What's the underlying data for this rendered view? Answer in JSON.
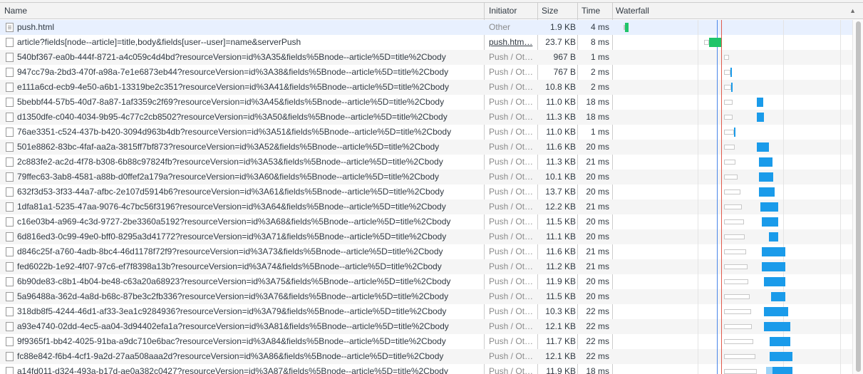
{
  "header": {
    "name": "Name",
    "initiator": "Initiator",
    "size": "Size",
    "time": "Time",
    "waterfall": "Waterfall",
    "sort_arrow": "▲"
  },
  "colors": {
    "receiving": "#1a9bea",
    "receiving_light": "#9dd4f7",
    "document": "#1fc46a",
    "dom_content_loaded": "#4a86e8",
    "load": "#e05a4c"
  },
  "rows": [
    {
      "name": "push.html",
      "initiator": "Other",
      "size": "1.9 KB",
      "time": "4 ms",
      "icon": "html-file-icon",
      "wf": {
        "wait": [
          0.042,
          0.048
        ],
        "recv": [
          0.048,
          0.062
        ],
        "color": "document"
      }
    },
    {
      "name": "article?fields[node--article]=title,body&fields[user--user]=name&serverPush",
      "initiator": "push.htm…",
      "size": "23.7 KB",
      "time": "8 ms",
      "icon": "file-icon",
      "wf": {
        "wait": [
          0.38,
          0.4
        ],
        "recv": [
          0.4,
          0.45
        ],
        "color": "document"
      }
    },
    {
      "name": "540bf367-ea0b-444f-8721-a4c059c4d4bd?resourceVersion=id%3A35&fields%5Bnode--article%5D=title%2Cbody",
      "initiator": "Push / Ot…",
      "size": "967 B",
      "time": "1 ms",
      "icon": "file-icon",
      "wf": {
        "wait": [
          0.462,
          0.484
        ],
        "recv": null
      }
    },
    {
      "name": "947cc79a-2bd3-470f-a98a-7e1e6873eb44?resourceVersion=id%3A38&fields%5Bnode--article%5D=title%2Cbody",
      "initiator": "Push / Ot…",
      "size": "767 B",
      "time": "2 ms",
      "icon": "file-icon",
      "wf": {
        "wait": [
          0.462,
          0.49
        ],
        "recv": [
          0.49,
          0.496
        ],
        "color": "receiving"
      }
    },
    {
      "name": "e111a6cd-ecb9-4e50-a6b1-13319be2c351?resourceVersion=id%3A41&fields%5Bnode--article%5D=title%2Cbody",
      "initiator": "Push / Ot…",
      "size": "10.8 KB",
      "time": "2 ms",
      "icon": "file-icon",
      "wf": {
        "wait": [
          0.462,
          0.494
        ],
        "recv": [
          0.494,
          0.5
        ],
        "color": "receiving"
      }
    },
    {
      "name": "5bebbf44-57b5-40d7-8a87-1af3359c2f69?resourceVersion=id%3A45&fields%5Bnode--article%5D=title%2Cbody",
      "initiator": "Push / Ot…",
      "size": "11.0 KB",
      "time": "18 ms",
      "icon": "file-icon",
      "wf": {
        "wait": [
          0.462,
          0.5
        ],
        "recv": [
          0.6,
          0.627
        ],
        "color": "receiving"
      }
    },
    {
      "name": "d1350dfe-c040-4034-9b95-4c77c2cb8502?resourceVersion=id%3A50&fields%5Bnode--article%5D=title%2Cbody",
      "initiator": "Push / Ot…",
      "size": "11.3 KB",
      "time": "18 ms",
      "icon": "file-icon",
      "wf": {
        "wait": [
          0.462,
          0.5
        ],
        "recv": [
          0.6,
          0.63
        ],
        "color": "receiving"
      }
    },
    {
      "name": "76ae3351-c524-437b-b420-3094d963b4db?resourceVersion=id%3A51&fields%5Bnode--article%5D=title%2Cbody",
      "initiator": "Push / Ot…",
      "size": "11.0 KB",
      "time": "1 ms",
      "icon": "file-icon",
      "wf": {
        "wait": [
          0.462,
          0.504
        ],
        "recv": [
          0.504,
          0.51
        ],
        "color": "receiving"
      }
    },
    {
      "name": "501e8862-83bc-4faf-aa2a-3815ff7bf873?resourceVersion=id%3A52&fields%5Bnode--article%5D=title%2Cbody",
      "initiator": "Push / Ot…",
      "size": "11.6 KB",
      "time": "20 ms",
      "icon": "file-icon",
      "wf": {
        "wait": [
          0.462,
          0.506
        ],
        "recv": [
          0.6,
          0.65
        ],
        "color": "receiving"
      }
    },
    {
      "name": "2c883fe2-ac2d-4f78-b308-6b88c97824fb?resourceVersion=id%3A53&fields%5Bnode--article%5D=title%2Cbody",
      "initiator": "Push / Ot…",
      "size": "11.3 KB",
      "time": "21 ms",
      "icon": "file-icon",
      "wf": {
        "wait": [
          0.462,
          0.51
        ],
        "recv": [
          0.61,
          0.665
        ],
        "color": "receiving"
      }
    },
    {
      "name": "79ffec63-3ab8-4581-a88b-d0ffef2a179a?resourceVersion=id%3A60&fields%5Bnode--article%5D=title%2Cbody",
      "initiator": "Push / Ot…",
      "size": "10.1 KB",
      "time": "20 ms",
      "icon": "file-icon",
      "wf": {
        "wait": [
          0.462,
          0.52
        ],
        "recv": [
          0.61,
          0.67
        ],
        "color": "receiving"
      }
    },
    {
      "name": "632f3d53-3f33-44a7-afbc-2e107d5914b6?resourceVersion=id%3A61&fields%5Bnode--article%5D=title%2Cbody",
      "initiator": "Push / Ot…",
      "size": "13.7 KB",
      "time": "20 ms",
      "icon": "file-icon",
      "wf": {
        "wait": [
          0.462,
          0.53
        ],
        "recv": [
          0.61,
          0.675
        ],
        "color": "receiving"
      }
    },
    {
      "name": "1dfa81a1-5235-47aa-9076-4c7bc56f3196?resourceVersion=id%3A64&fields%5Bnode--article%5D=title%2Cbody",
      "initiator": "Push / Ot…",
      "size": "12.2 KB",
      "time": "21 ms",
      "icon": "file-icon",
      "wf": {
        "wait": [
          0.462,
          0.538
        ],
        "recv": [
          0.615,
          0.69
        ],
        "color": "receiving"
      }
    },
    {
      "name": "c16e03b4-a969-4c3d-9727-2be3360a5192?resourceVersion=id%3A68&fields%5Bnode--article%5D=title%2Cbody",
      "initiator": "Push / Ot…",
      "size": "11.5 KB",
      "time": "20 ms",
      "icon": "file-icon",
      "wf": {
        "wait": [
          0.462,
          0.545
        ],
        "recv": [
          0.62,
          0.69
        ],
        "color": "receiving"
      }
    },
    {
      "name": "6d816ed3-0c99-49e0-bff0-8295a3d41772?resourceVersion=id%3A71&fields%5Bnode--article%5D=title%2Cbody",
      "initiator": "Push / Ot…",
      "size": "11.1 KB",
      "time": "20 ms",
      "icon": "file-icon",
      "wf": {
        "wait": [
          0.462,
          0.55
        ],
        "recv": [
          0.65,
          0.69
        ],
        "color": "receiving"
      }
    },
    {
      "name": "d846c25f-a760-4adb-8bc4-46d1178f72f9?resourceVersion=id%3A73&fields%5Bnode--article%5D=title%2Cbody",
      "initiator": "Push / Ot…",
      "size": "11.6 KB",
      "time": "21 ms",
      "icon": "file-icon",
      "wf": {
        "wait": [
          0.462,
          0.555
        ],
        "recv": [
          0.62,
          0.72
        ],
        "color": "receiving"
      }
    },
    {
      "name": "fed6022b-1e92-4f07-97c6-ef7f8398a13b?resourceVersion=id%3A74&fields%5Bnode--article%5D=title%2Cbody",
      "initiator": "Push / Ot…",
      "size": "11.2 KB",
      "time": "21 ms",
      "icon": "file-icon",
      "wf": {
        "wait": [
          0.462,
          0.56
        ],
        "recv": [
          0.62,
          0.72
        ],
        "color": "receiving"
      }
    },
    {
      "name": "6b90de83-c8b1-4b04-be48-c63a20a68923?resourceVersion=id%3A75&fields%5Bnode--article%5D=title%2Cbody",
      "initiator": "Push / Ot…",
      "size": "11.9 KB",
      "time": "20 ms",
      "icon": "file-icon",
      "wf": {
        "wait": [
          0.462,
          0.565
        ],
        "recv": [
          0.63,
          0.72
        ],
        "color": "receiving"
      }
    },
    {
      "name": "5a96488a-362d-4a8d-b68c-87be3c2fb336?resourceVersion=id%3A76&fields%5Bnode--article%5D=title%2Cbody",
      "initiator": "Push / Ot…",
      "size": "11.5 KB",
      "time": "20 ms",
      "icon": "file-icon",
      "wf": {
        "wait": [
          0.462,
          0.57
        ],
        "recv": [
          0.66,
          0.72
        ],
        "color": "receiving"
      }
    },
    {
      "name": "318db8f5-4244-46d1-af33-3ea1c9284936?resourceVersion=id%3A79&fields%5Bnode--article%5D=title%2Cbody",
      "initiator": "Push / Ot…",
      "size": "10.3 KB",
      "time": "22 ms",
      "icon": "file-icon",
      "wf": {
        "wait": [
          0.462,
          0.575
        ],
        "recv": [
          0.63,
          0.73
        ],
        "color": "receiving"
      }
    },
    {
      "name": "a93e4740-02dd-4ec5-aa04-3d94402efa1a?resourceVersion=id%3A81&fields%5Bnode--article%5D=title%2Cbody",
      "initiator": "Push / Ot…",
      "size": "12.1 KB",
      "time": "22 ms",
      "icon": "file-icon",
      "wf": {
        "wait": [
          0.462,
          0.58
        ],
        "recv": [
          0.63,
          0.74
        ],
        "color": "receiving"
      }
    },
    {
      "name": "9f9365f1-bb42-4025-91ba-a9dc710e6bac?resourceVersion=id%3A84&fields%5Bnode--article%5D=title%2Cbody",
      "initiator": "Push / Ot…",
      "size": "11.7 KB",
      "time": "22 ms",
      "icon": "file-icon",
      "wf": {
        "wait": [
          0.462,
          0.585
        ],
        "recv": [
          0.655,
          0.74
        ],
        "color": "receiving"
      }
    },
    {
      "name": "fc88e842-f6b4-4cf1-9a2d-27aa508aaa2d?resourceVersion=id%3A86&fields%5Bnode--article%5D=title%2Cbody",
      "initiator": "Push / Ot…",
      "size": "12.1 KB",
      "time": "22 ms",
      "icon": "file-icon",
      "wf": {
        "wait": [
          0.462,
          0.595
        ],
        "recv": [
          0.655,
          0.75
        ],
        "color": "receiving"
      }
    },
    {
      "name": "a14fd011-d324-493a-b17d-ae0a382c0427?resourceVersion=id%3A87&fields%5Bnode--article%5D=title%2Cbody",
      "initiator": "Push / Ot…",
      "size": "11.9 KB",
      "time": "18 ms",
      "icon": "file-icon",
      "wf": {
        "wait": [
          0.462,
          0.6
        ],
        "recv": [
          0.665,
          0.75
        ],
        "color": "receiving",
        "pre": [
          0.64,
          0.665
        ]
      }
    }
  ]
}
